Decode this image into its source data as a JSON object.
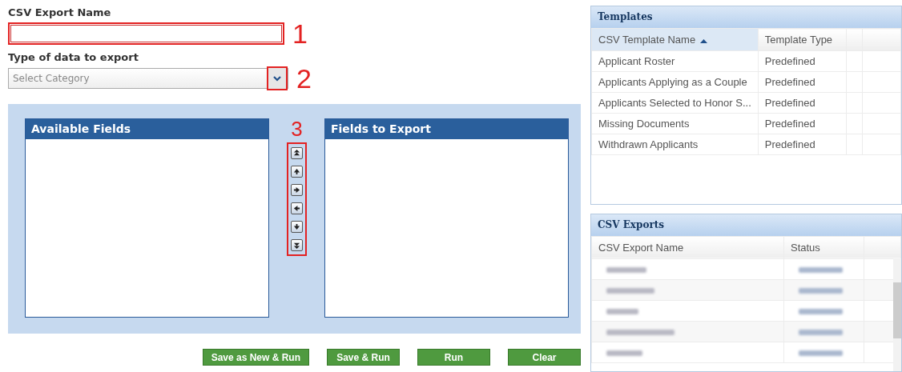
{
  "form": {
    "name_label": "CSV Export Name",
    "name_annotation": "1",
    "type_label": "Type of data to export",
    "type_placeholder": "Select Category",
    "type_annotation": "2"
  },
  "arrows_annotation": "3",
  "lists": [
    {
      "title": "Available Fields"
    },
    {
      "title": "Fields to Export"
    }
  ],
  "buttons": [
    "Save as New & Run",
    "Save & Run",
    "Run",
    "Clear"
  ],
  "templates": {
    "title": "Templates",
    "columns": [
      {
        "label": "CSV Template Name",
        "sorted": true
      },
      {
        "label": "Template Type",
        "sorted": false
      }
    ],
    "rows": [
      [
        "Applicant Roster",
        "Predefined"
      ],
      [
        "Applicants Applying as a Couple",
        "Predefined"
      ],
      [
        "Applicants Selected to Honor S...",
        "Predefined"
      ],
      [
        "Missing Documents",
        "Predefined"
      ],
      [
        "Withdrawn Applicants",
        "Predefined"
      ]
    ]
  },
  "exports": {
    "title": "CSV Exports",
    "columns": [
      {
        "label": "CSV Export Name"
      },
      {
        "label": "Status"
      }
    ]
  }
}
